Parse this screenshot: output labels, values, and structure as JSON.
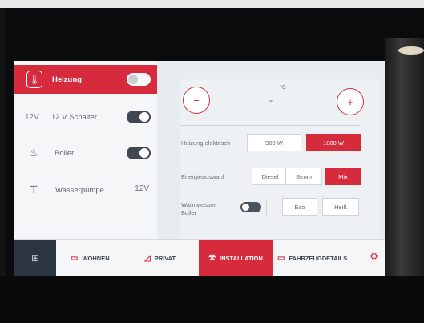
{
  "colors": {
    "accent": "#d62b3d",
    "dark": "#2a3540"
  },
  "left_panel": {
    "heizung": {
      "label": "Heizung",
      "icon": "thermometer-icon",
      "toggle": "on"
    },
    "schalter_12v": {
      "voltage": "12V",
      "label": "12 V Schalter",
      "toggle": "off"
    },
    "boiler": {
      "label": "Boiler",
      "icon": "flame-icon",
      "toggle": "off"
    },
    "wasserpumpe": {
      "label": "Wasserpumpe",
      "icon": "faucet-icon",
      "voltage_badge": "12V"
    }
  },
  "right_panel": {
    "minus": "−",
    "plus": "+",
    "temperature": "-",
    "unit": "°C",
    "heizung_elektrisch": {
      "label": "Heizung elektrisch",
      "options": [
        "900 W",
        "1800 W"
      ],
      "selected": "1800 W"
    },
    "energieauswahl": {
      "label": "Energieauswahl",
      "options": [
        "Diesel",
        "Strom",
        "Mix"
      ],
      "selected": "Mix"
    },
    "warmwasser": {
      "label_line1": "Warmwasser",
      "label_line2": "Boiler",
      "toggle": "off",
      "options": [
        "Eco",
        "Heiß"
      ]
    }
  },
  "nav": {
    "items": [
      {
        "label": "WOHNEN",
        "icon": "sofa-icon"
      },
      {
        "label": "PRIVAT",
        "icon": "privacy-icon"
      },
      {
        "label": "INSTALLATION",
        "icon": "installation-icon",
        "active": true
      },
      {
        "label": "FAHRZEUGDETAILS",
        "icon": "vehicle-icon"
      }
    ]
  }
}
